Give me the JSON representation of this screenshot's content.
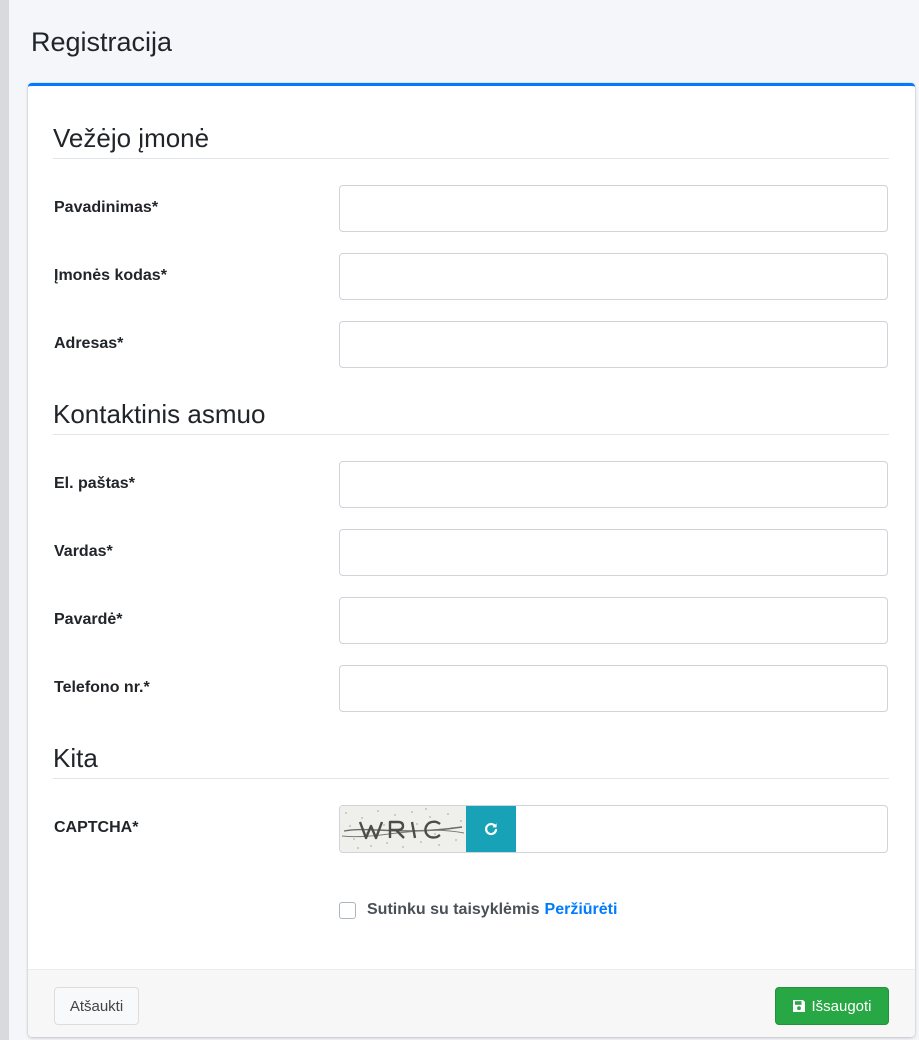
{
  "page": {
    "title": "Registracija"
  },
  "theme": {
    "accent": "#007bff",
    "refresh_button": "#17a2b8",
    "save_button": "#28a745"
  },
  "sections": {
    "company": {
      "title": "Vežėjo įmonė",
      "name_label": "Pavadinimas*",
      "code_label": "Įmonės kodas*",
      "address_label": "Adresas*"
    },
    "contact": {
      "title": "Kontaktinis asmuo",
      "email_label": "El. paštas*",
      "first_name_label": "Vardas*",
      "last_name_label": "Pavardė*",
      "phone_label": "Telefono nr.*"
    },
    "other": {
      "title": "Kita",
      "captcha_label": "CAPTCHA*",
      "captcha_refresh_icon": "refresh-icon"
    }
  },
  "fields": {
    "name_value": "",
    "code_value": "",
    "address_value": "",
    "email_value": "",
    "first_name_value": "",
    "last_name_value": "",
    "phone_value": "",
    "captcha_value": ""
  },
  "agreement": {
    "text": "Sutinku su taisyklėmis",
    "link": "Peržiūrėti",
    "checked": false
  },
  "footer": {
    "cancel_label": "Atšaukti",
    "save_label": "Išsaugoti",
    "save_icon": "floppy-disk-icon"
  }
}
